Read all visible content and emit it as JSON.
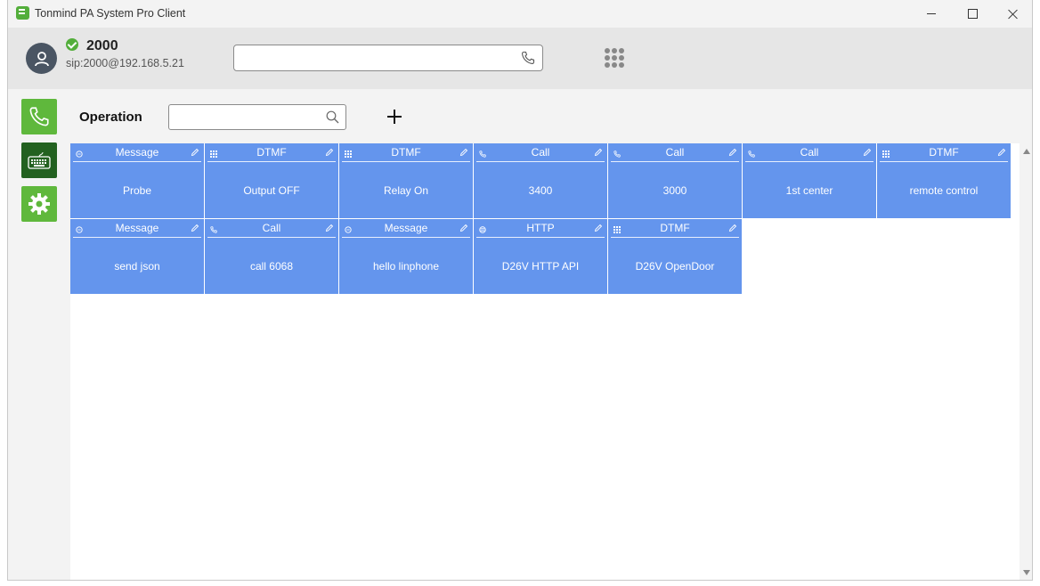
{
  "window": {
    "title": "Tonmind PA System Pro Client",
    "minimize_icon": "minimize-icon",
    "maximize_icon": "maximize-icon",
    "close_icon": "close-icon"
  },
  "header": {
    "user_number": "2000",
    "sip_uri": "sip:2000@192.168.5.21",
    "status": "online",
    "status_color": "#53ae3b",
    "dial_value": "",
    "dial_icon": "phone-icon",
    "keypad_icon": "dialpad-icon"
  },
  "sidebar": {
    "items": [
      {
        "icon": "phone-icon",
        "color": "#5fb83c"
      },
      {
        "icon": "keyboard-icon",
        "color": "#236120",
        "active": true
      },
      {
        "icon": "gear-icon",
        "color": "#5fb83c"
      }
    ]
  },
  "operation": {
    "label": "Operation",
    "search_value": "",
    "search_icon": "search-icon",
    "add_icon": "plus-icon"
  },
  "tiles": [
    {
      "type": "Message",
      "name": "Probe",
      "icon": "message-icon"
    },
    {
      "type": "DTMF",
      "name": "Output OFF",
      "icon": "keypad-icon"
    },
    {
      "type": "DTMF",
      "name": "Relay On",
      "icon": "keypad-icon"
    },
    {
      "type": "Call",
      "name": "3400",
      "icon": "phone-icon"
    },
    {
      "type": "Call",
      "name": "3000",
      "icon": "phone-icon"
    },
    {
      "type": "Call",
      "name": "1st center",
      "icon": "phone-icon"
    },
    {
      "type": "DTMF",
      "name": "remote control",
      "icon": "keypad-icon"
    },
    {
      "type": "Message",
      "name": "send json",
      "icon": "message-icon"
    },
    {
      "type": "Call",
      "name": "call 6068",
      "icon": "phone-icon"
    },
    {
      "type": "Message",
      "name": "hello linphone",
      "icon": "message-icon"
    },
    {
      "type": "HTTP",
      "name": "D26V HTTP API",
      "icon": "http-icon"
    },
    {
      "type": "DTMF",
      "name": "D26V OpenDoor",
      "icon": "keypad-icon"
    }
  ],
  "colors": {
    "tile": "#6495ed",
    "accent": "#5fb83c",
    "accent_dark": "#236120"
  }
}
